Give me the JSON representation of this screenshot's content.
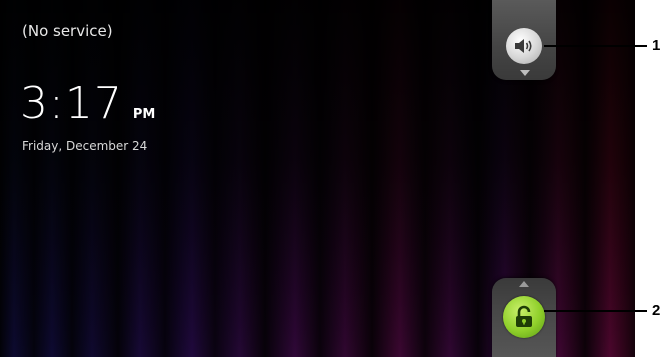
{
  "status": {
    "carrier": "(No service)"
  },
  "clock": {
    "time": "3:17",
    "ampm": "PM",
    "date": "Friday, December 24"
  },
  "controls": {
    "sound_icon": "speaker-volume-icon",
    "unlock_icon": "unlock-padlock-icon"
  },
  "callouts": [
    "1",
    "2"
  ],
  "colors": {
    "unlock_green": "#8fcf2a",
    "tab_gray": "#4a4a4a"
  }
}
